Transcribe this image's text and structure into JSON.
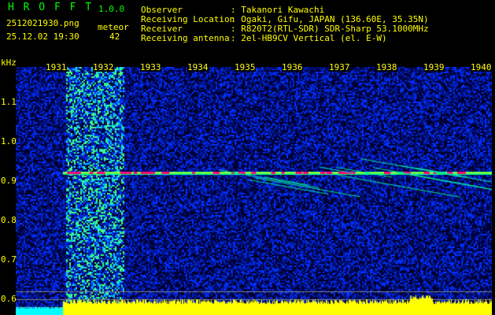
{
  "header": {
    "app_name": "H R O F F T",
    "version": "1.0.0",
    "filename": "2512021930.png",
    "datetime": "25.12.02 19:30",
    "meteor_label": "meteor",
    "meteor_count": "42",
    "info": [
      {
        "label": "Observer",
        "value": ": Takanori Kawachi"
      },
      {
        "label": "Receiving Location",
        "value": ": Ogaki, Gifu, JAPAN (136.60E, 35.35N)"
      },
      {
        "label": "Receiver",
        "value": ": R820T2(RTL-SDR) SDR-Sharp 53.1000MHz"
      },
      {
        "label": "Receiving antenna",
        "value": ": 2el-HB9CV Vertical (el. E-W)"
      }
    ]
  },
  "colors": {
    "text": "#ffff00",
    "title": "#00ff00",
    "noise": "#0010a0",
    "signal": "#ff0080",
    "level": "#ffff00",
    "low_level": "#00ffff"
  },
  "chart_data": {
    "type": "heatmap",
    "title": "HROFFT spectrogram",
    "ylabel": "kHz",
    "x_ticks": [
      "1931",
      "1932",
      "1933",
      "1934",
      "1935",
      "1936",
      "1937",
      "1938",
      "1939",
      "1940"
    ],
    "y_ticks": [
      "1.1",
      "1.0",
      "0.9",
      "0.8",
      "0.7",
      "0.6"
    ],
    "ylim": [
      0.56,
      1.19
    ],
    "carrier_khz": 0.92,
    "interference_band": [
      1930.4,
      1931.8
    ]
  }
}
